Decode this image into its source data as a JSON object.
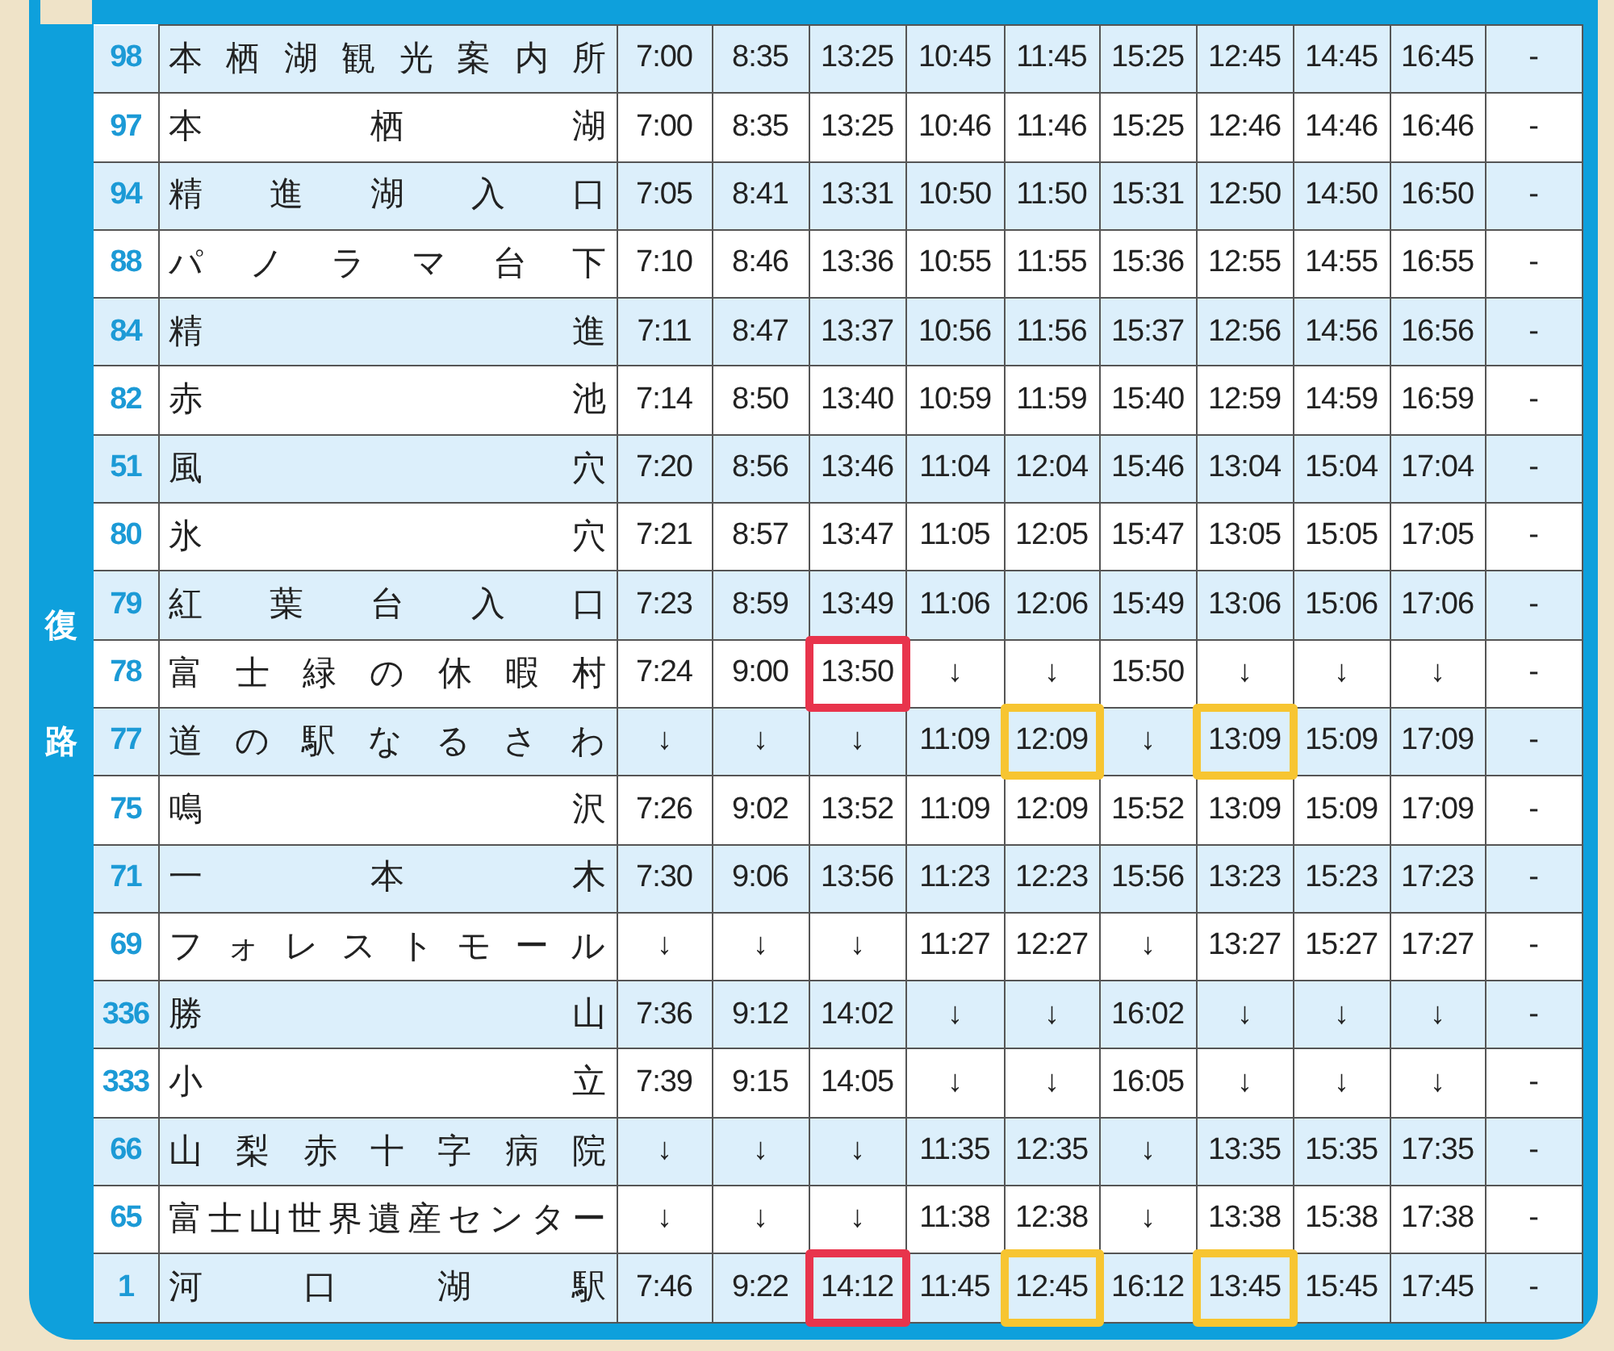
{
  "direction_label": "復路",
  "rows": [
    {
      "stop": "98",
      "name": "本栖湖観光案内所",
      "times": [
        {
          "text": "7:00"
        },
        {
          "text": "8:35"
        },
        {
          "text": "13:25"
        },
        {
          "text": "10:45"
        },
        {
          "text": "11:45"
        },
        {
          "text": "15:25"
        },
        {
          "text": "12:45"
        },
        {
          "text": "14:45"
        },
        {
          "text": "16:45"
        },
        {
          "text": "-"
        }
      ]
    },
    {
      "stop": "97",
      "name": "本栖湖",
      "times": [
        {
          "text": "7:00"
        },
        {
          "text": "8:35"
        },
        {
          "text": "13:25"
        },
        {
          "text": "10:46"
        },
        {
          "text": "11:46"
        },
        {
          "text": "15:25"
        },
        {
          "text": "12:46"
        },
        {
          "text": "14:46"
        },
        {
          "text": "16:46"
        },
        {
          "text": "-"
        }
      ]
    },
    {
      "stop": "94",
      "name": "精進湖入口",
      "times": [
        {
          "text": "7:05"
        },
        {
          "text": "8:41"
        },
        {
          "text": "13:31"
        },
        {
          "text": "10:50"
        },
        {
          "text": "11:50"
        },
        {
          "text": "15:31"
        },
        {
          "text": "12:50"
        },
        {
          "text": "14:50"
        },
        {
          "text": "16:50"
        },
        {
          "text": "-"
        }
      ]
    },
    {
      "stop": "88",
      "name": "パノラマ台下",
      "times": [
        {
          "text": "7:10"
        },
        {
          "text": "8:46"
        },
        {
          "text": "13:36"
        },
        {
          "text": "10:55"
        },
        {
          "text": "11:55"
        },
        {
          "text": "15:36"
        },
        {
          "text": "12:55"
        },
        {
          "text": "14:55"
        },
        {
          "text": "16:55"
        },
        {
          "text": "-"
        }
      ]
    },
    {
      "stop": "84",
      "name": "精進",
      "times": [
        {
          "text": "7:11"
        },
        {
          "text": "8:47"
        },
        {
          "text": "13:37"
        },
        {
          "text": "10:56"
        },
        {
          "text": "11:56"
        },
        {
          "text": "15:37"
        },
        {
          "text": "12:56"
        },
        {
          "text": "14:56"
        },
        {
          "text": "16:56"
        },
        {
          "text": "-"
        }
      ]
    },
    {
      "stop": "82",
      "name": "赤池",
      "times": [
        {
          "text": "7:14"
        },
        {
          "text": "8:50"
        },
        {
          "text": "13:40"
        },
        {
          "text": "10:59"
        },
        {
          "text": "11:59"
        },
        {
          "text": "15:40"
        },
        {
          "text": "12:59"
        },
        {
          "text": "14:59"
        },
        {
          "text": "16:59"
        },
        {
          "text": "-"
        }
      ]
    },
    {
      "stop": "51",
      "name": "風穴",
      "times": [
        {
          "text": "7:20"
        },
        {
          "text": "8:56"
        },
        {
          "text": "13:46"
        },
        {
          "text": "11:04"
        },
        {
          "text": "12:04"
        },
        {
          "text": "15:46"
        },
        {
          "text": "13:04"
        },
        {
          "text": "15:04"
        },
        {
          "text": "17:04"
        },
        {
          "text": "-"
        }
      ]
    },
    {
      "stop": "80",
      "name": "氷穴",
      "times": [
        {
          "text": "7:21"
        },
        {
          "text": "8:57"
        },
        {
          "text": "13:47"
        },
        {
          "text": "11:05"
        },
        {
          "text": "12:05"
        },
        {
          "text": "15:47"
        },
        {
          "text": "13:05"
        },
        {
          "text": "15:05"
        },
        {
          "text": "17:05"
        },
        {
          "text": "-"
        }
      ]
    },
    {
      "stop": "79",
      "name": "紅葉台入口",
      "times": [
        {
          "text": "7:23"
        },
        {
          "text": "8:59"
        },
        {
          "text": "13:49"
        },
        {
          "text": "11:06"
        },
        {
          "text": "12:06"
        },
        {
          "text": "15:49"
        },
        {
          "text": "13:06"
        },
        {
          "text": "15:06"
        },
        {
          "text": "17:06"
        },
        {
          "text": "-"
        }
      ]
    },
    {
      "stop": "78",
      "name": "富士緑の休暇村",
      "times": [
        {
          "text": "7:24"
        },
        {
          "text": "9:00"
        },
        {
          "text": "13:50",
          "color": "#e8344c"
        },
        {
          "text": "↓"
        },
        {
          "text": "↓"
        },
        {
          "text": "15:50"
        },
        {
          "text": "↓"
        },
        {
          "text": "↓"
        },
        {
          "text": "↓"
        },
        {
          "text": "-"
        }
      ]
    },
    {
      "stop": "77",
      "name": "道の駅なるさわ",
      "times": [
        {
          "text": "↓"
        },
        {
          "text": "↓"
        },
        {
          "text": "↓"
        },
        {
          "text": "11:09"
        },
        {
          "text": "12:09",
          "color": "#f7c531"
        },
        {
          "text": "↓"
        },
        {
          "text": "13:09",
          "color": "#f7c531"
        },
        {
          "text": "15:09"
        },
        {
          "text": "17:09"
        },
        {
          "text": "-"
        }
      ]
    },
    {
      "stop": "75",
      "name": "鳴沢",
      "times": [
        {
          "text": "7:26"
        },
        {
          "text": "9:02"
        },
        {
          "text": "13:52"
        },
        {
          "text": "11:09"
        },
        {
          "text": "12:09"
        },
        {
          "text": "15:52"
        },
        {
          "text": "13:09"
        },
        {
          "text": "15:09"
        },
        {
          "text": "17:09"
        },
        {
          "text": "-"
        }
      ]
    },
    {
      "stop": "71",
      "name": "一本木",
      "times": [
        {
          "text": "7:30"
        },
        {
          "text": "9:06"
        },
        {
          "text": "13:56"
        },
        {
          "text": "11:23"
        },
        {
          "text": "12:23"
        },
        {
          "text": "15:56"
        },
        {
          "text": "13:23"
        },
        {
          "text": "15:23"
        },
        {
          "text": "17:23"
        },
        {
          "text": "-"
        }
      ]
    },
    {
      "stop": "69",
      "name": "フォレストモール",
      "times": [
        {
          "text": "↓"
        },
        {
          "text": "↓"
        },
        {
          "text": "↓"
        },
        {
          "text": "11:27"
        },
        {
          "text": "12:27"
        },
        {
          "text": "↓"
        },
        {
          "text": "13:27"
        },
        {
          "text": "15:27"
        },
        {
          "text": "17:27"
        },
        {
          "text": "-"
        }
      ]
    },
    {
      "stop": "336",
      "name": "勝山",
      "times": [
        {
          "text": "7:36"
        },
        {
          "text": "9:12"
        },
        {
          "text": "14:02"
        },
        {
          "text": "↓"
        },
        {
          "text": "↓"
        },
        {
          "text": "16:02"
        },
        {
          "text": "↓"
        },
        {
          "text": "↓"
        },
        {
          "text": "↓"
        },
        {
          "text": "-"
        }
      ]
    },
    {
      "stop": "333",
      "name": "小立",
      "times": [
        {
          "text": "7:39"
        },
        {
          "text": "9:15"
        },
        {
          "text": "14:05"
        },
        {
          "text": "↓"
        },
        {
          "text": "↓"
        },
        {
          "text": "16:05"
        },
        {
          "text": "↓"
        },
        {
          "text": "↓"
        },
        {
          "text": "↓"
        },
        {
          "text": "-"
        }
      ]
    },
    {
      "stop": "66",
      "name": "山梨赤十字病院",
      "times": [
        {
          "text": "↓"
        },
        {
          "text": "↓"
        },
        {
          "text": "↓"
        },
        {
          "text": "11:35"
        },
        {
          "text": "12:35"
        },
        {
          "text": "↓"
        },
        {
          "text": "13:35"
        },
        {
          "text": "15:35"
        },
        {
          "text": "17:35"
        },
        {
          "text": "-"
        }
      ]
    },
    {
      "stop": "65",
      "name": "富士山世界遺産センター",
      "times": [
        {
          "text": "↓"
        },
        {
          "text": "↓"
        },
        {
          "text": "↓"
        },
        {
          "text": "11:38"
        },
        {
          "text": "12:38"
        },
        {
          "text": "↓"
        },
        {
          "text": "13:38"
        },
        {
          "text": "15:38"
        },
        {
          "text": "17:38"
        },
        {
          "text": "-"
        }
      ]
    },
    {
      "stop": "1",
      "name": "河口湖駅",
      "times": [
        {
          "text": "7:46"
        },
        {
          "text": "9:22"
        },
        {
          "text": "14:12",
          "color": "#e8344c"
        },
        {
          "text": "11:45"
        },
        {
          "text": "12:45",
          "color": "#f7c531"
        },
        {
          "text": "16:12"
        },
        {
          "text": "13:45",
          "color": "#f7c531"
        },
        {
          "text": "15:45"
        },
        {
          "text": "17:45"
        },
        {
          "text": "-"
        }
      ]
    }
  ]
}
